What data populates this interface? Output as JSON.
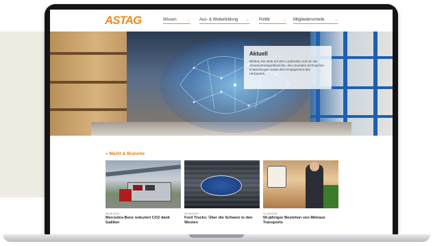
{
  "brand": {
    "logo_text": "ASTAG",
    "accent": "#f08a1c"
  },
  "nav": {
    "items": [
      {
        "label": "Wissen"
      },
      {
        "label": "Aus- & Weiterbildung"
      },
      {
        "label": "Politik"
      },
      {
        "label": "Mitgliedervorteile"
      }
    ]
  },
  "hero": {
    "title": "Aktuell",
    "text": "Bleiben Sie stets auf dem Laufenden und um die Strassentransportbranche, den neuesten technischen Entwicklungen sowie dem Engagement des Verbandes."
  },
  "section": {
    "title": "Markt & Branche",
    "marker": "»"
  },
  "cards": [
    {
      "date": "06.08.2024",
      "title": "Mercedes-Benz reduziert CO2 dank Galliker"
    },
    {
      "date": "23.08.2024",
      "title": "Ford Trucks: Über die Schweiz in den Westen"
    },
    {
      "date": "22.08.2024",
      "title": "66-jähriges Bestehen von Métraux Transports"
    }
  ]
}
